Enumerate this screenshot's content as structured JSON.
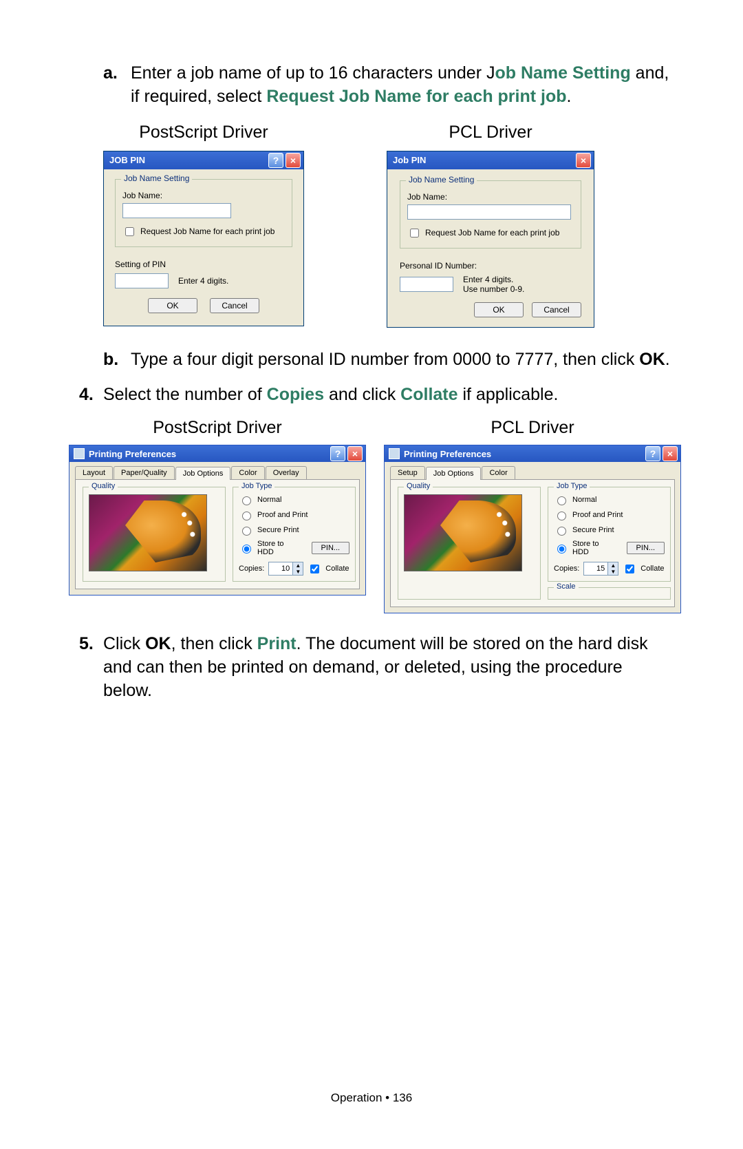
{
  "step_a": {
    "prefix": "a.",
    "text1": "Enter a job name of up to 16 characters under J",
    "green1": "ob Name Setting",
    "text2": " and, if required, select ",
    "green2": "Request Job Name for each print job",
    "text3": "."
  },
  "labels": {
    "postscript": "PostScript Driver",
    "pcl": "PCL Driver"
  },
  "dlg_ps": {
    "title": "JOB PIN",
    "group": "Job Name Setting",
    "jobname_label": "Job Name:",
    "checkbox": "Request Job Name for each print job",
    "pin_section": "Setting of PIN",
    "pin_hint": "Enter 4 digits.",
    "ok": "OK",
    "cancel": "Cancel"
  },
  "dlg_pcl": {
    "title": "Job PIN",
    "group": "Job Name Setting",
    "jobname_label": "Job Name:",
    "checkbox": "Request Job Name for each print job",
    "pin_label": "Personal ID Number:",
    "hint1": "Enter 4 digits.",
    "hint2": "Use number 0-9.",
    "ok": "OK",
    "cancel": "Cancel"
  },
  "step_b": {
    "prefix": "b.",
    "text1": "Type a four digit personal ID number from 0000 to 7777, then click ",
    "bold": "OK",
    "text2": "."
  },
  "step_4": {
    "prefix": "4.",
    "text1": "Select the number of ",
    "green1": "Copies",
    "text2": " and click ",
    "green2": "Collate",
    "text3": " if applicable."
  },
  "prefs_ps": {
    "title": "Printing Preferences",
    "tabs": [
      "Layout",
      "Paper/Quality",
      "Job Options",
      "Color",
      "Overlay"
    ],
    "active_tab": "Job Options",
    "quality_legend": "Quality",
    "jobtype_legend": "Job Type",
    "radios": [
      "Normal",
      "Proof and Print",
      "Secure Print",
      "Store to HDD"
    ],
    "selected_radio": "Store to HDD",
    "pin_btn": "PIN...",
    "copies_label": "Copies:",
    "copies_value": "10",
    "collate": "Collate"
  },
  "prefs_pcl": {
    "title": "Printing Preferences",
    "tabs": [
      "Setup",
      "Job Options",
      "Color"
    ],
    "active_tab": "Job Options",
    "quality_legend": "Quality",
    "jobtype_legend": "Job Type",
    "radios": [
      "Normal",
      "Proof and Print",
      "Secure Print",
      "Store to HDD"
    ],
    "selected_radio": "Store to HDD",
    "pin_btn": "PIN...",
    "copies_label": "Copies:",
    "copies_value": "15",
    "collate": "Collate",
    "scale_legend": "Scale"
  },
  "step_5": {
    "prefix": "5.",
    "text1": "Click ",
    "bold1": "OK",
    "text2": ", then click ",
    "green1": "Print",
    "text3": ". The document will be stored on the hard disk and can then be printed on demand, or deleted, using the procedure below."
  },
  "footer": "Operation • 136"
}
